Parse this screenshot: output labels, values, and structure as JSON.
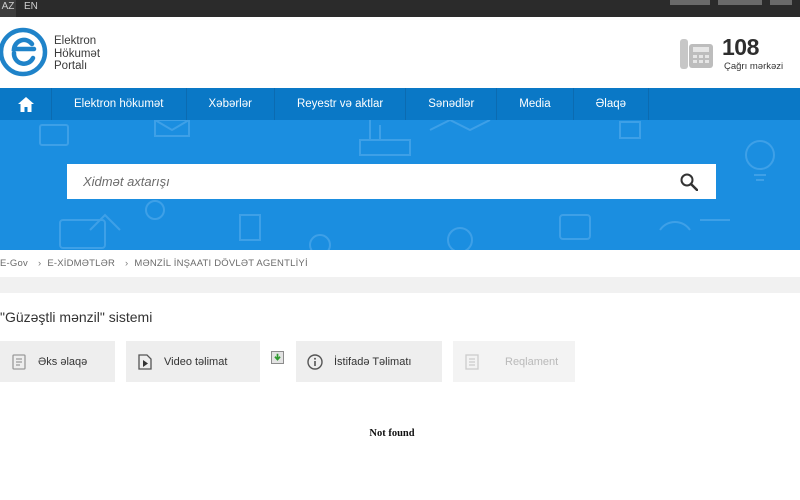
{
  "topbar": {
    "languages": [
      "AZ",
      "EN"
    ]
  },
  "header": {
    "logo_lines": [
      "Elektron",
      "Hökumət",
      "Portalı"
    ],
    "call_number": "108",
    "call_label": "Çağrı mərkəzi"
  },
  "nav": {
    "home_icon": "home-icon",
    "items": [
      "Elektron hökumət",
      "Xəbərlər",
      "Reyestr və aktlar",
      "Sənədlər",
      "Media",
      "Əlaqə"
    ]
  },
  "search": {
    "placeholder": "Xidmət axtarışı",
    "icon": "search-icon"
  },
  "breadcrumb": [
    "E-Gov",
    "E-XİDMƏTLƏR",
    "MƏNZİL İNŞAATI DÖVLƏT AGENTLİYİ"
  ],
  "page": {
    "title": "\"Güzəştli mənzil\" sistemi",
    "buttons": [
      {
        "label": "Əks əlaqə",
        "icon": "feedback-icon"
      },
      {
        "label": "Video təlimat",
        "icon": "video-icon"
      },
      {
        "label": "İstifadə Təlimatı",
        "icon": "info-icon"
      },
      {
        "label": "Reqlament",
        "icon": "document-icon"
      }
    ],
    "not_found": "Not found"
  },
  "colors": {
    "nav_blue": "#0a78c6",
    "hero_blue": "#1b8ee0",
    "logo_blue": "#1f83c9"
  }
}
